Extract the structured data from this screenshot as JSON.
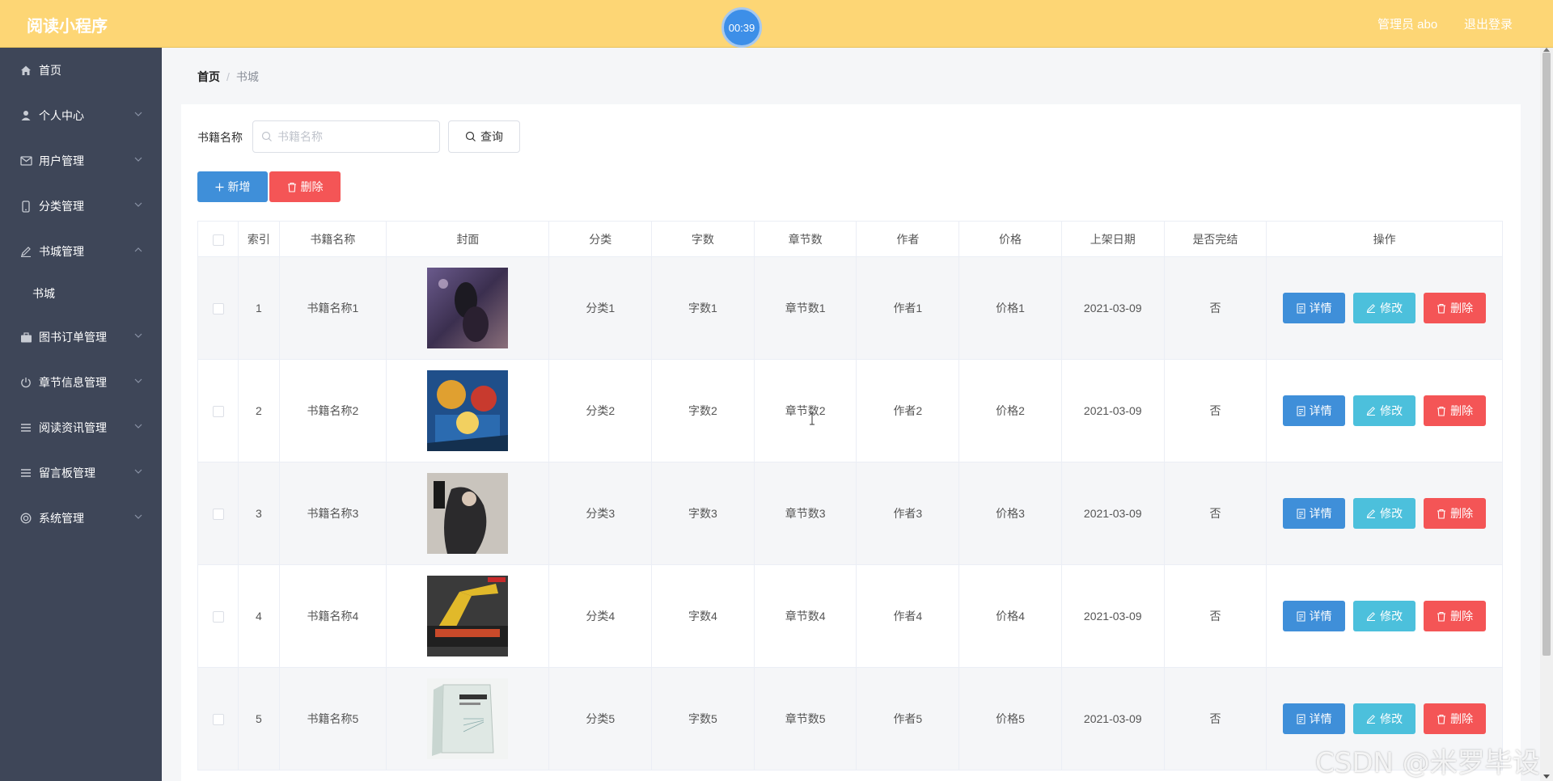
{
  "header": {
    "app_title": "阅读小程序",
    "timer": "00:39",
    "admin_label": "管理员 abo",
    "logout": "退出登录"
  },
  "sidebar": {
    "items": [
      {
        "label": "首页",
        "icon": "home-icon"
      },
      {
        "label": "个人中心",
        "icon": "user-icon"
      },
      {
        "label": "用户管理",
        "icon": "mail-icon"
      },
      {
        "label": "分类管理",
        "icon": "phone-icon"
      },
      {
        "label": "书城管理",
        "icon": "edit-icon",
        "expanded": true
      },
      {
        "label": "图书订单管理",
        "icon": "briefcase-icon"
      },
      {
        "label": "章节信息管理",
        "icon": "power-icon"
      },
      {
        "label": "阅读资讯管理",
        "icon": "list-icon"
      },
      {
        "label": "留言板管理",
        "icon": "list-icon"
      },
      {
        "label": "系统管理",
        "icon": "settings-circle-icon"
      }
    ],
    "sub_items": [
      {
        "label": "书城"
      }
    ]
  },
  "breadcrumb": {
    "home": "首页",
    "separator": "/",
    "current": "书城"
  },
  "search": {
    "label": "书籍名称",
    "placeholder": "书籍名称",
    "value": "",
    "query_label": "查询"
  },
  "toolbar": {
    "add_label": "新增",
    "delete_label": "删除"
  },
  "table": {
    "columns": [
      "索引",
      "书籍名称",
      "封面",
      "分类",
      "字数",
      "章节数",
      "作者",
      "价格",
      "上架日期",
      "是否完结",
      "操作"
    ],
    "rows": [
      {
        "index": "1",
        "name": "书籍名称1",
        "category": "分类1",
        "words": "字数1",
        "chapters": "章节数1",
        "author": "作者1",
        "price": "价格1",
        "date": "2021-03-09",
        "finished": "否"
      },
      {
        "index": "2",
        "name": "书籍名称2",
        "category": "分类2",
        "words": "字数2",
        "chapters": "章节数2",
        "author": "作者2",
        "price": "价格2",
        "date": "2021-03-09",
        "finished": "否"
      },
      {
        "index": "3",
        "name": "书籍名称3",
        "category": "分类3",
        "words": "字数3",
        "chapters": "章节数3",
        "author": "作者3",
        "price": "价格3",
        "date": "2021-03-09",
        "finished": "否"
      },
      {
        "index": "4",
        "name": "书籍名称4",
        "category": "分类4",
        "words": "字数4",
        "chapters": "章节数4",
        "author": "作者4",
        "price": "价格4",
        "date": "2021-03-09",
        "finished": "否"
      },
      {
        "index": "5",
        "name": "书籍名称5",
        "category": "分类5",
        "words": "字数5",
        "chapters": "章节数5",
        "author": "作者5",
        "price": "价格5",
        "date": "2021-03-09",
        "finished": "否"
      }
    ],
    "actions": {
      "detail": "详情",
      "edit": "修改",
      "delete": "删除"
    }
  },
  "watermark": "CSDN @米罗毕设",
  "colors": {
    "header_bg": "#fdd675",
    "sidebar_bg": "#3e4658",
    "primary": "#3f8fd9",
    "info": "#4cc0dc",
    "danger": "#f45556"
  }
}
